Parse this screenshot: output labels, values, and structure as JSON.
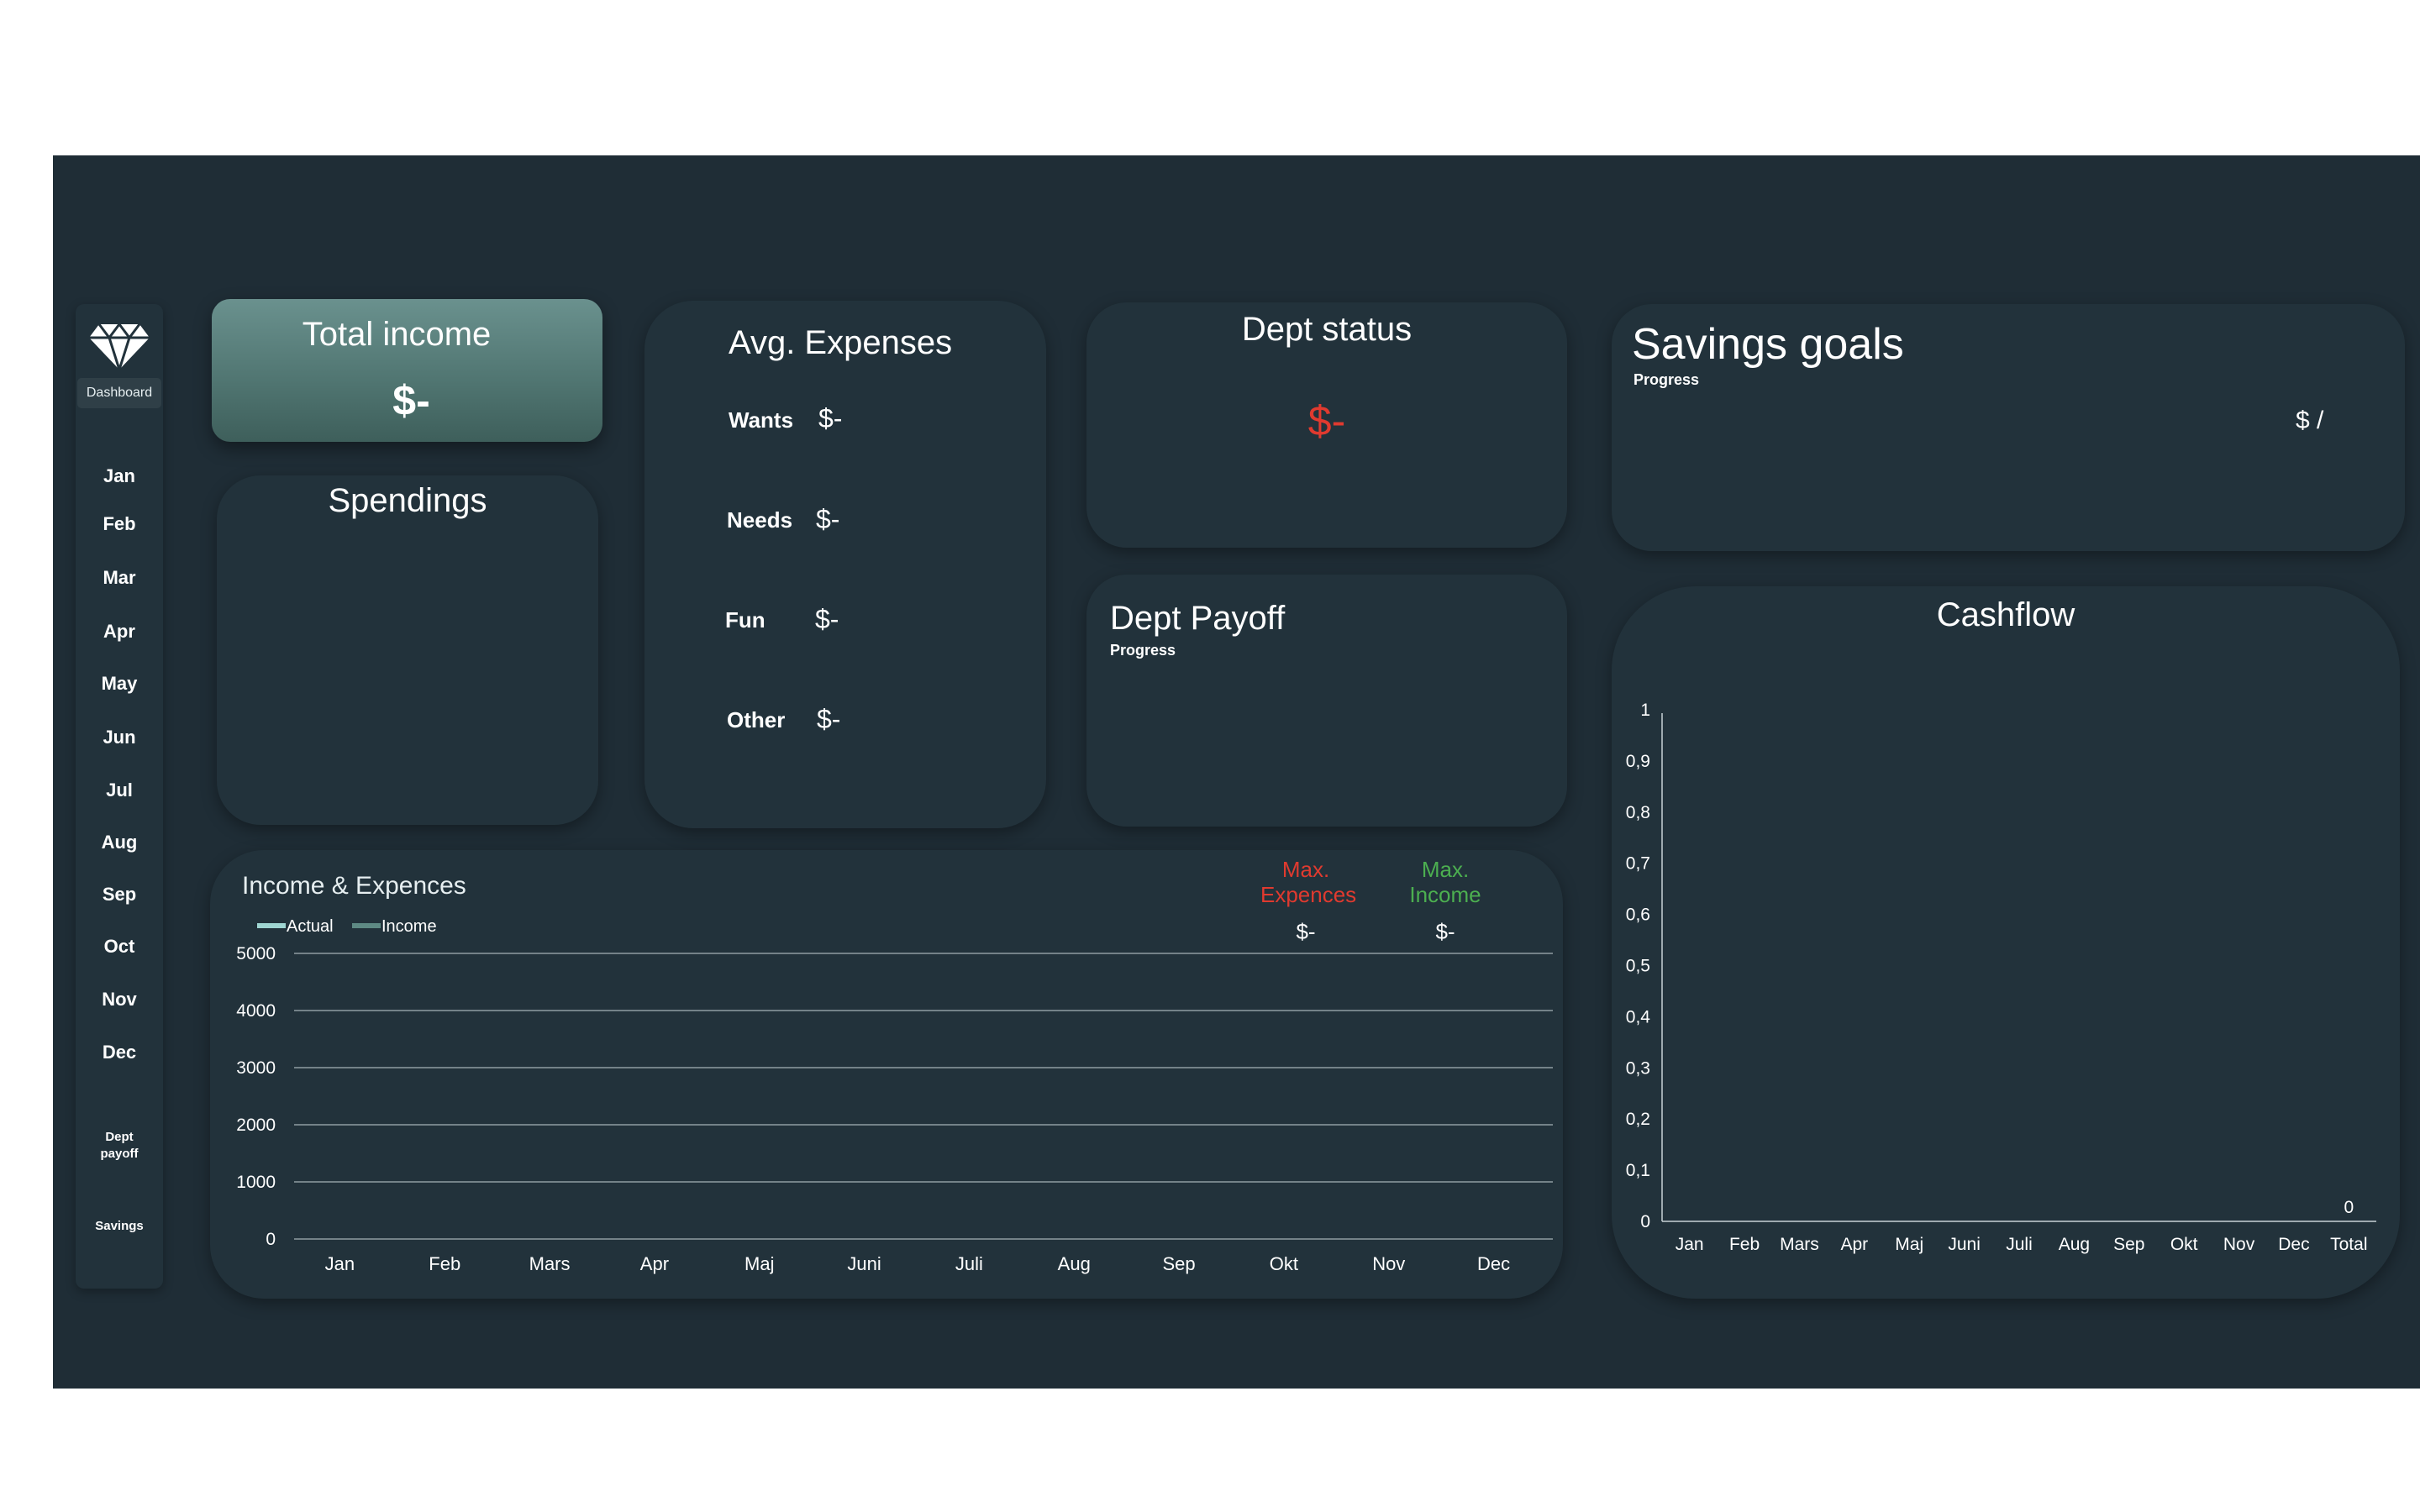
{
  "colors": {
    "background": "#1f2d36",
    "card": "#22323b",
    "accent": "#5c8582",
    "negative": "#e03a2f",
    "positive": "#4caf50"
  },
  "sidebar": {
    "logo_icon": "diamond-icon",
    "dashboard_label": "Dashboard",
    "months": [
      "Jan",
      "Feb",
      "Mar",
      "Apr",
      "May",
      "Jun",
      "Jul",
      "Aug",
      "Sep",
      "Oct",
      "Nov",
      "Dec"
    ],
    "dept_payoff_line1": "Dept",
    "dept_payoff_line2": "payoff",
    "savings_label": "Savings"
  },
  "total_income": {
    "title": "Total income",
    "value": "$-"
  },
  "spendings": {
    "title": "Spendings"
  },
  "avg_expenses": {
    "title": "Avg. Expenses",
    "rows": [
      {
        "label": "Wants",
        "value": "$-"
      },
      {
        "label": "Needs",
        "value": "$-"
      },
      {
        "label": "Fun",
        "value": "$-"
      },
      {
        "label": "Other",
        "value": "$-"
      }
    ]
  },
  "dept_status": {
    "title": "Dept status",
    "value": "$-"
  },
  "dept_payoff": {
    "title": "Dept Payoff",
    "subtitle": "Progress"
  },
  "savings_goals": {
    "title": "Savings goals",
    "subtitle": "Progress",
    "value": "$ /"
  },
  "income_expences": {
    "title": "Income & Expences",
    "max_expences_line1": "Max.",
    "max_expences_line2": "Expences",
    "max_expences_value": "$-",
    "max_income_line1": "Max.",
    "max_income_line2": "Income",
    "max_income_value": "$-"
  },
  "cashflow": {
    "title": "Cashflow"
  },
  "chart_data": [
    {
      "type": "line",
      "title": "Income & Expences",
      "legend": [
        "Actual",
        "Income"
      ],
      "legend_placement": "top-left",
      "categories": [
        "Jan",
        "Feb",
        "Mars",
        "Apr",
        "Maj",
        "Juni",
        "Juli",
        "Aug",
        "Sep",
        "Okt",
        "Nov",
        "Dec"
      ],
      "series": [
        {
          "name": "Actual",
          "values": [],
          "color": "#9fd6d2"
        },
        {
          "name": "Income",
          "values": [],
          "color": "#5e8a84"
        }
      ],
      "yticks": [
        "0",
        "1000",
        "2000",
        "3000",
        "4000",
        "5000"
      ],
      "ylim": [
        0,
        5000
      ],
      "grid": true
    },
    {
      "type": "bar",
      "title": "Cashflow",
      "categories": [
        "Jan",
        "Feb",
        "Mars",
        "Apr",
        "Maj",
        "Juni",
        "Juli",
        "Aug",
        "Sep",
        "Okt",
        "Nov",
        "Dec",
        "Total"
      ],
      "values": [
        0,
        0,
        0,
        0,
        0,
        0,
        0,
        0,
        0,
        0,
        0,
        0,
        0
      ],
      "data_labels": {
        "Total": "0"
      },
      "yticks": [
        "0",
        "0,1",
        "0,2",
        "0,3",
        "0,4",
        "0,5",
        "0,6",
        "0,7",
        "0,8",
        "0,9",
        "1"
      ],
      "ylim": [
        0,
        1
      ],
      "grid": false
    }
  ]
}
